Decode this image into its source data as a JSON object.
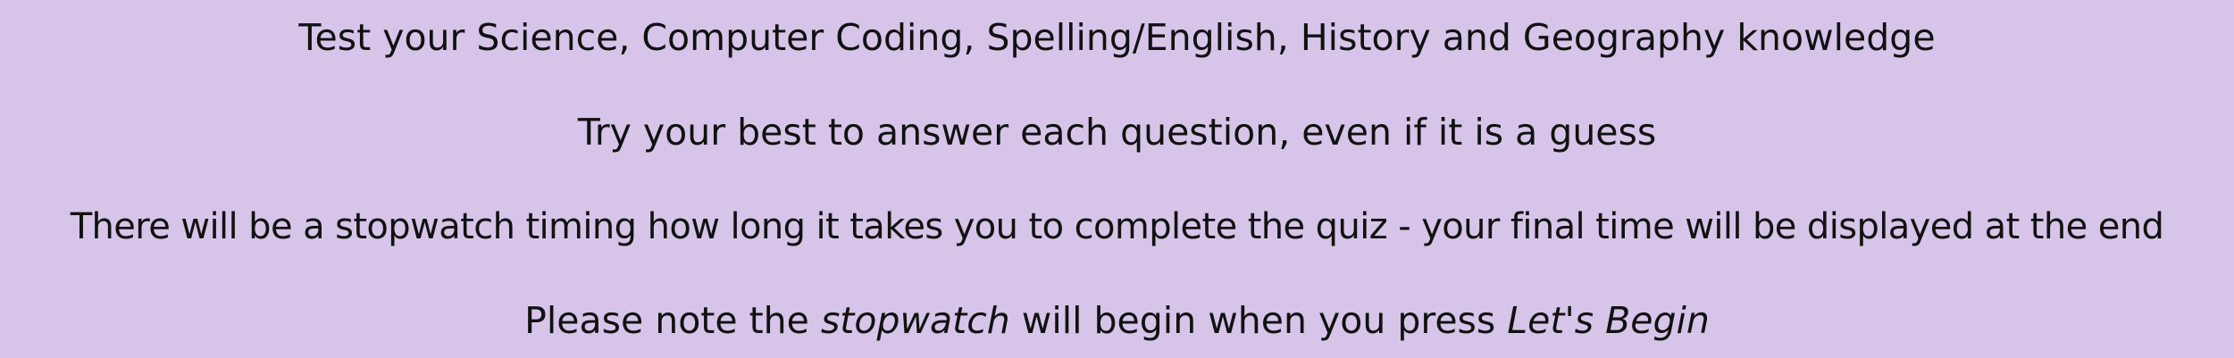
{
  "colors": {
    "background": "#d6c5e9",
    "text": "#111111"
  },
  "instructions": {
    "line1": "Test your Science, Computer Coding, Spelling/English, History and Geography knowledge",
    "line2": "Try your best to answer each question, even if it is a guess",
    "line3": "There will be a stopwatch timing how long it takes you to complete the quiz - your final time will be displayed at the end",
    "line4": {
      "part1": "Please note the ",
      "emphasis1": "stopwatch",
      "part2": " will begin when you press ",
      "emphasis2": "Let's Begin"
    }
  }
}
